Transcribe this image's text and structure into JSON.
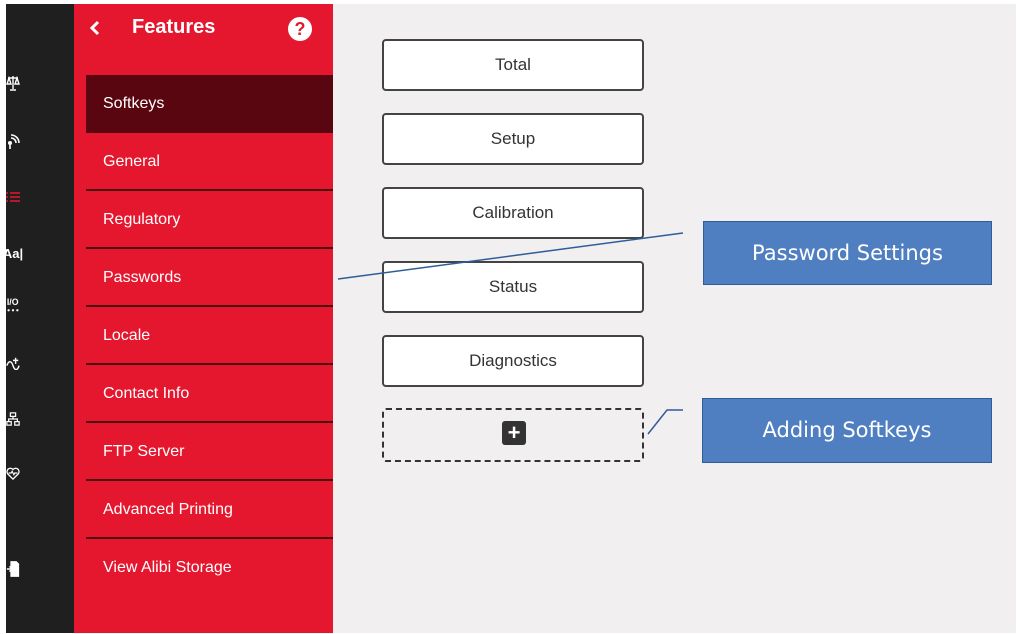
{
  "menu": {
    "title": "Features",
    "help_glyph": "?",
    "items": [
      {
        "label": "Softkeys",
        "active": true
      },
      {
        "label": "General"
      },
      {
        "label": "Regulatory"
      },
      {
        "label": "Passwords"
      },
      {
        "label": "Locale"
      },
      {
        "label": "Contact Info"
      },
      {
        "label": "FTP Server"
      },
      {
        "label": "Advanced Printing"
      },
      {
        "label": "View Alibi Storage"
      }
    ]
  },
  "rail": {
    "icons": [
      "scale-icon",
      "network-icon",
      "list-icon",
      "text-format-icon",
      "io-icon",
      "transfer-icon",
      "hierarchy-icon",
      "health-icon",
      "export-icon"
    ],
    "text_icons": {
      "format": "Aa|",
      "io": "I/O"
    }
  },
  "softkeys": [
    {
      "label": "Total"
    },
    {
      "label": "Setup"
    },
    {
      "label": "Calibration"
    },
    {
      "label": "Status"
    },
    {
      "label": "Diagnostics"
    }
  ],
  "add_softkey": {
    "glyph": "+"
  },
  "callouts": {
    "password_settings": "Password Settings",
    "adding_softkeys": "Adding Softkeys"
  },
  "colors": {
    "menu_red": "#e5172e",
    "active_item": "#5a0610",
    "rail": "#1f1f1f",
    "content_bg": "#f1eff0",
    "callout_blue": "#4f7fc0"
  }
}
